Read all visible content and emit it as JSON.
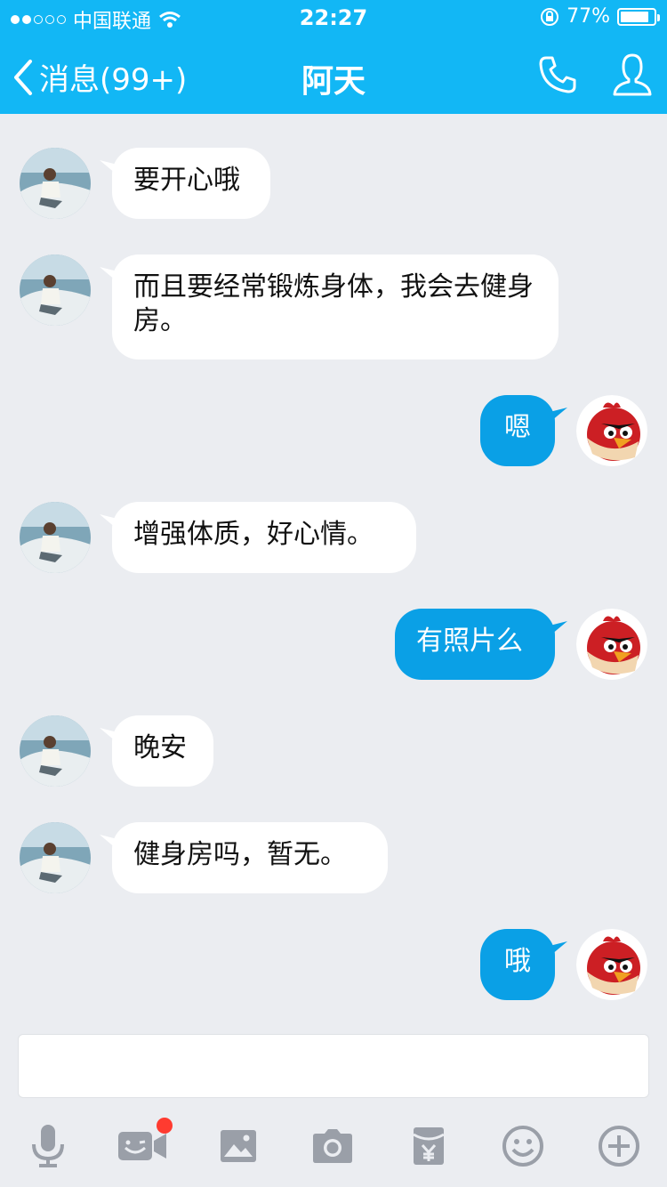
{
  "status_bar": {
    "carrier": "中国联通",
    "time": "22:27",
    "battery": "77%",
    "battery_level": 0.77
  },
  "nav": {
    "back_label": "消息(99+)",
    "title": "阿天",
    "icons": [
      "phone-icon",
      "profile-icon"
    ]
  },
  "messages": [
    {
      "side": "left",
      "text": "要开心哦"
    },
    {
      "side": "left",
      "text": "而且要经常锻炼身体，我会去健身房。"
    },
    {
      "side": "right",
      "text": "嗯"
    },
    {
      "side": "left",
      "text": "增强体质，好心情。"
    },
    {
      "side": "right",
      "text": "有照片么"
    },
    {
      "side": "left",
      "text": "晚安"
    },
    {
      "side": "left",
      "text": "健身房吗，暂无。"
    },
    {
      "side": "right",
      "text": "哦"
    }
  ],
  "input": {
    "value": "",
    "placeholder": ""
  },
  "toolbar": {
    "icons": [
      "microphone-icon",
      "video-chat-icon",
      "image-icon",
      "camera-icon",
      "red-packet-icon",
      "emoji-icon",
      "plus-icon"
    ],
    "video_badge": true
  },
  "colors": {
    "header": "#12b7f5",
    "outgoing_bubble": "#0aa0e6",
    "incoming_bubble": "#ffffff",
    "background": "#ebedf1",
    "icon_gray": "#9a9fa8"
  }
}
